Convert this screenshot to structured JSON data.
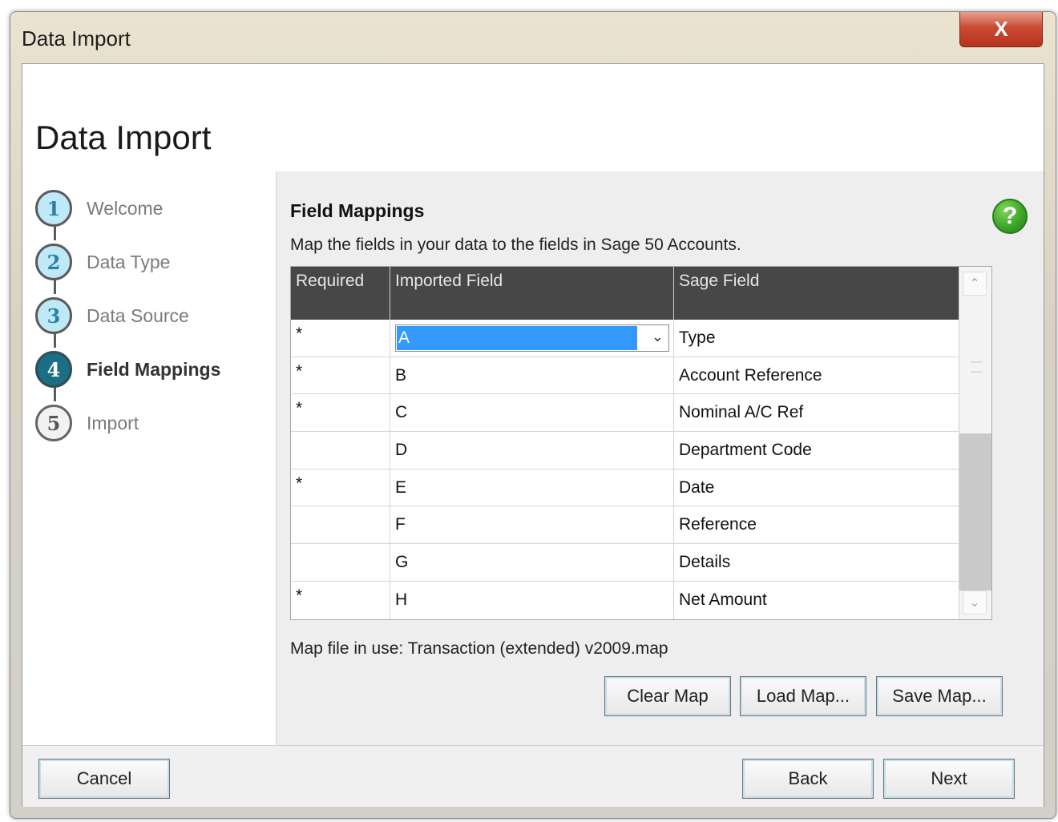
{
  "window": {
    "title": "Data Import",
    "close_label": "X"
  },
  "header": {
    "title": "Data Import"
  },
  "steps": [
    {
      "number": "1",
      "label": "Welcome"
    },
    {
      "number": "2",
      "label": "Data Type"
    },
    {
      "number": "3",
      "label": "Data Source"
    },
    {
      "number": "4",
      "label": "Field Mappings"
    },
    {
      "number": "5",
      "label": "Import"
    }
  ],
  "main": {
    "title": "Field Mappings",
    "description": "Map the fields in your data to the fields in Sage 50 Accounts.",
    "help_icon": "?",
    "columns": {
      "required": "Required",
      "imported": "Imported Field",
      "sage": "Sage Field"
    },
    "rows": [
      {
        "required": "*",
        "imported": "A",
        "sage": "Type"
      },
      {
        "required": "*",
        "imported": "B",
        "sage": "Account Reference"
      },
      {
        "required": "*",
        "imported": "C",
        "sage": "Nominal A/C Ref"
      },
      {
        "required": "",
        "imported": "D",
        "sage": "Department Code"
      },
      {
        "required": "*",
        "imported": "E",
        "sage": "Date"
      },
      {
        "required": "",
        "imported": "F",
        "sage": "Reference"
      },
      {
        "required": "",
        "imported": "G",
        "sage": "Details"
      },
      {
        "required": "*",
        "imported": "H",
        "sage": "Net Amount"
      }
    ],
    "map_file": "Map file in use: Transaction (extended) v2009.map",
    "buttons": {
      "clear": "Clear Map",
      "load": "Load Map...",
      "save": "Save Map..."
    }
  },
  "footer": {
    "cancel": "Cancel",
    "back": "Back",
    "next": "Next"
  }
}
